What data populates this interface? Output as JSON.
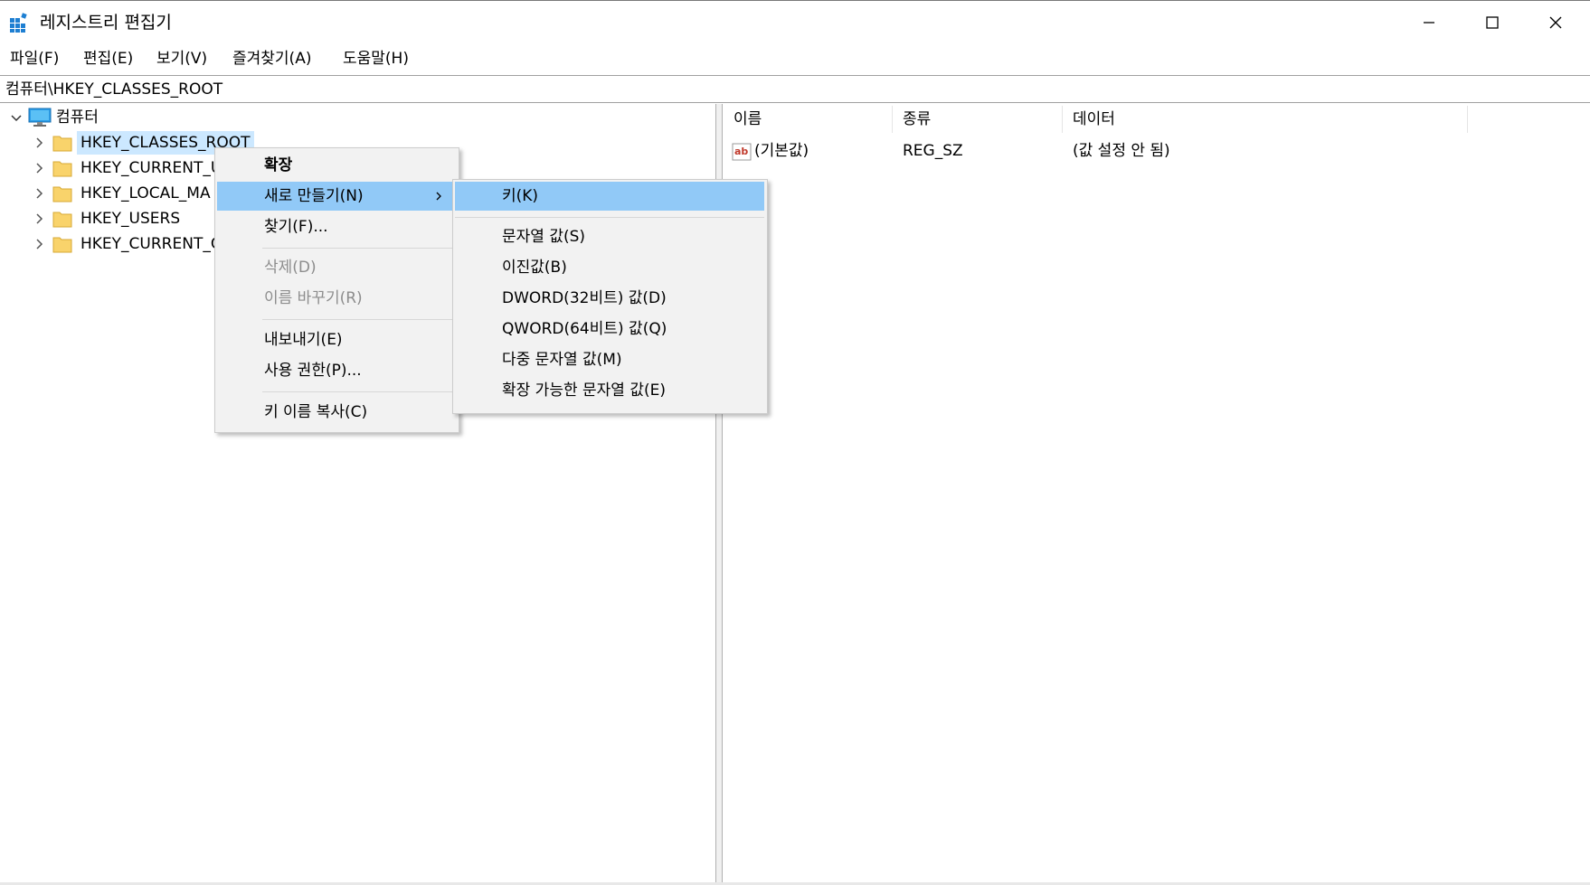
{
  "window": {
    "title": "레지스트리 편집기",
    "accent": "#0078d7"
  },
  "menu": {
    "file": "파일(F)",
    "edit": "편집(E)",
    "view": "보기(V)",
    "favorites": "즐겨찾기(A)",
    "help": "도움말(H)"
  },
  "address": {
    "path": "컴퓨터\\HKEY_CLASSES_ROOT"
  },
  "tree": {
    "root": "컴퓨터",
    "items": [
      {
        "label": "HKEY_CLASSES_ROOT",
        "selected": true
      },
      {
        "label": "HKEY_CURRENT_U"
      },
      {
        "label": "HKEY_LOCAL_MA"
      },
      {
        "label": "HKEY_USERS"
      },
      {
        "label": "HKEY_CURRENT_C"
      }
    ]
  },
  "list": {
    "columns": {
      "name": "이름",
      "type": "종류",
      "data": "데이터"
    },
    "rows": [
      {
        "name": "(기본값)",
        "type": "REG_SZ",
        "data": "(값 설정 안 됨)",
        "icon": "string-value-icon"
      }
    ]
  },
  "context_menu": {
    "expand": "확장",
    "new": "새로 만들기(N)",
    "find": "찾기(F)...",
    "delete": "삭제(D)",
    "rename": "이름 바꾸기(R)",
    "export": "내보내기(E)",
    "permissions": "사용 권한(P)...",
    "copy_key_name": "키 이름 복사(C)"
  },
  "submenu": {
    "key": "키(K)",
    "string_value": "문자열 값(S)",
    "binary_value": "이진값(B)",
    "dword_value": "DWORD(32비트) 값(D)",
    "qword_value": "QWORD(64비트) 값(Q)",
    "multi_string_value": "다중 문자열 값(M)",
    "expandable_string_value": "확장 가능한 문자열 값(E)"
  },
  "colors": {
    "highlight": "#91c9f7",
    "selection": "#cce8ff",
    "menu_bg": "#f2f2f2",
    "disabled_text": "#8d8d8d",
    "folder": "#f9d36b"
  }
}
